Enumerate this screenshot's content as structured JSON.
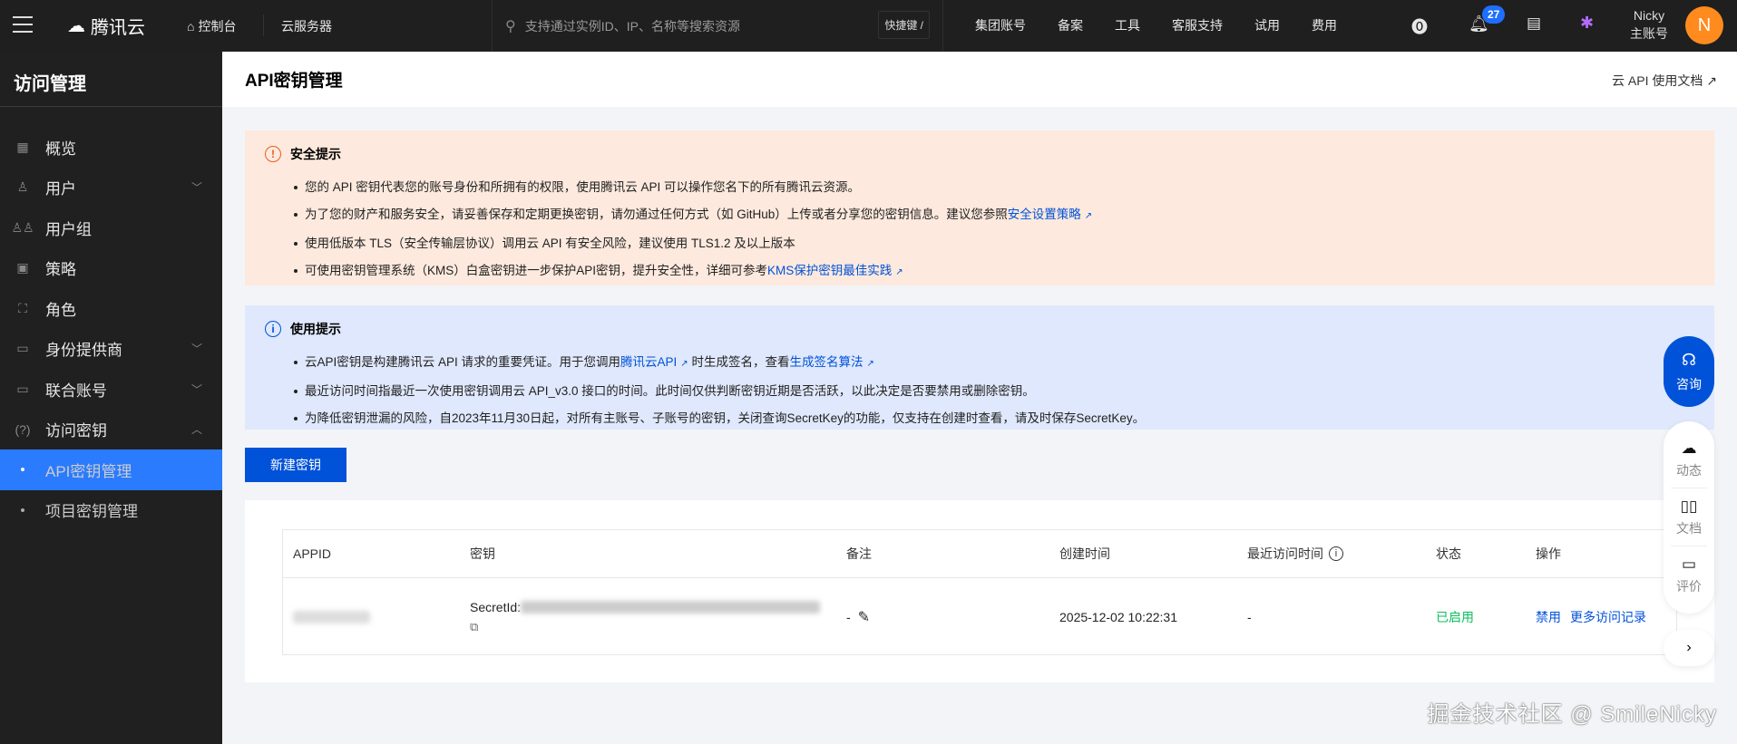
{
  "topbar": {
    "brand": "腾讯云",
    "console": "控制台",
    "product": "云服务器",
    "search_placeholder": "支持通过实例ID、IP、名称等搜索资源",
    "shortcut": "快捷键 /",
    "links": [
      "集团账号",
      "备案",
      "工具",
      "客服支持",
      "试用",
      "费用"
    ],
    "notification_count": "27",
    "user_name": "Nicky",
    "user_role": "主账号",
    "avatar_letter": "N"
  },
  "sidebar": {
    "title": "访问管理",
    "items": [
      {
        "label": "概览",
        "icon": "grid-icon",
        "chevron": ""
      },
      {
        "label": "用户",
        "icon": "user-icon",
        "chevron": "﹀"
      },
      {
        "label": "用户组",
        "icon": "users-icon",
        "chevron": ""
      },
      {
        "label": "策略",
        "icon": "policy-icon",
        "chevron": ""
      },
      {
        "label": "角色",
        "icon": "role-icon",
        "chevron": ""
      },
      {
        "label": "身份提供商",
        "icon": "idp-icon",
        "chevron": "﹀"
      },
      {
        "label": "联合账号",
        "icon": "federated-icon",
        "chevron": "﹀"
      },
      {
        "label": "访问密钥",
        "icon": "key-icon",
        "chevron": "︿"
      }
    ],
    "subitems": [
      "API密钥管理",
      "项目密钥管理"
    ]
  },
  "page": {
    "title": "API密钥管理",
    "doc_link": "云 API 使用文档"
  },
  "security": {
    "title": "安全提示",
    "items": [
      {
        "text": "您的 API 密钥代表您的账号身份和所拥有的权限，使用腾讯云 API 可以操作您名下的所有腾讯云资源。"
      },
      {
        "text": "为了您的财产和服务安全，请妥善保存和定期更换密钥，请勿通过任何方式（如 GitHub）上传或者分享您的密钥信息。建议您参照",
        "link": "安全设置策略"
      },
      {
        "text": "使用低版本 TLS（安全传输层协议）调用云 API 有安全风险，建议使用 TLS1.2 及以上版本"
      },
      {
        "text": "可使用密钥管理系统（KMS）白盒密钥进一步保护API密钥，提升安全性，详细可参考",
        "link": "KMS保护密钥最佳实践"
      }
    ]
  },
  "usage": {
    "title": "使用提示",
    "items": [
      {
        "pre": "云API密钥是构建腾讯云 API 请求的重要凭证。用于您调用",
        "link1": "腾讯云API",
        "mid": "时生成签名，查看",
        "link2": "生成签名算法"
      },
      {
        "text": "最近访问时间指最近一次使用密钥调用云 API_v3.0 接口的时间。此时间仅供判断密钥近期是否活跃，以此决定是否要禁用或删除密钥。"
      },
      {
        "text": "为降低密钥泄漏的风险，自2023年11月30日起，对所有主账号、子账号的密钥，关闭查询SecretKey的功能，仅支持在创建时查看，请及时保存SecretKey。"
      }
    ]
  },
  "new_key_button": "新建密钥",
  "table": {
    "headers": [
      "APPID",
      "密钥",
      "备注",
      "创建时间",
      "最近访问时间",
      "状态",
      "操作"
    ],
    "rows": [
      {
        "secret_label": "SecretId:",
        "remark": "-",
        "created": "2025-12-02 10:22:31",
        "last_access": "-",
        "status": "已启用",
        "actions": [
          "禁用",
          "更多访问记录"
        ]
      }
    ]
  },
  "float": {
    "consult": "咨询",
    "items": [
      "动态",
      "文档",
      "评价"
    ]
  },
  "watermark": "掘金技术社区 @ SmileNicky",
  "colors": {
    "primary": "#0052d9",
    "active": "#2a7bfe",
    "status_ok": "#0abf5b",
    "warn_bg": "#fde9dd",
    "info_bg": "#dfe8fc"
  }
}
